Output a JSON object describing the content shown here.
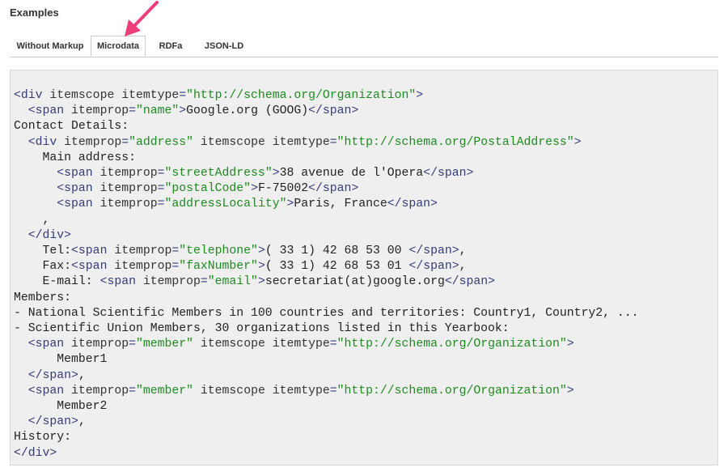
{
  "heading": "Examples",
  "tabs": [
    {
      "label": "Without Markup",
      "active": false
    },
    {
      "label": "Microdata",
      "active": true
    },
    {
      "label": "RDFa",
      "active": false
    },
    {
      "label": "JSON-LD",
      "active": false
    }
  ],
  "annotation_arrow_color": "#ee3d7a",
  "code_lines": [
    [
      [
        "t",
        "<div "
      ],
      [
        "a",
        "itemscope itemtype"
      ],
      [
        "t",
        "="
      ],
      [
        "v",
        "\"http://schema.org/Organization\""
      ],
      [
        "t",
        ">"
      ]
    ],
    [
      [
        "p",
        "  "
      ],
      [
        "t",
        "<span "
      ],
      [
        "a",
        "itemprop"
      ],
      [
        "t",
        "="
      ],
      [
        "v",
        "\"name\""
      ],
      [
        "t",
        ">"
      ],
      [
        "p",
        "Google.org (GOOG)"
      ],
      [
        "t",
        "</span>"
      ]
    ],
    [
      [
        "p",
        "Contact Details:"
      ]
    ],
    [
      [
        "p",
        "  "
      ],
      [
        "t",
        "<div "
      ],
      [
        "a",
        "itemprop"
      ],
      [
        "t",
        "="
      ],
      [
        "v",
        "\"address\""
      ],
      [
        "a",
        " itemscope itemtype"
      ],
      [
        "t",
        "="
      ],
      [
        "v",
        "\"http://schema.org/PostalAddress\""
      ],
      [
        "t",
        ">"
      ]
    ],
    [
      [
        "p",
        "    Main address:"
      ]
    ],
    [
      [
        "p",
        "      "
      ],
      [
        "t",
        "<span "
      ],
      [
        "a",
        "itemprop"
      ],
      [
        "t",
        "="
      ],
      [
        "v",
        "\"streetAddress\""
      ],
      [
        "t",
        ">"
      ],
      [
        "p",
        "38 avenue de l'Opera"
      ],
      [
        "t",
        "</span>"
      ]
    ],
    [
      [
        "p",
        "      "
      ],
      [
        "t",
        "<span "
      ],
      [
        "a",
        "itemprop"
      ],
      [
        "t",
        "="
      ],
      [
        "v",
        "\"postalCode\""
      ],
      [
        "t",
        ">"
      ],
      [
        "p",
        "F-75002"
      ],
      [
        "t",
        "</span>"
      ]
    ],
    [
      [
        "p",
        "      "
      ],
      [
        "t",
        "<span "
      ],
      [
        "a",
        "itemprop"
      ],
      [
        "t",
        "="
      ],
      [
        "v",
        "\"addressLocality\""
      ],
      [
        "t",
        ">"
      ],
      [
        "p",
        "Paris, France"
      ],
      [
        "t",
        "</span>"
      ]
    ],
    [
      [
        "p",
        "    ,"
      ]
    ],
    [
      [
        "p",
        "  "
      ],
      [
        "t",
        "</div>"
      ]
    ],
    [
      [
        "p",
        "    Tel:"
      ],
      [
        "t",
        "<span "
      ],
      [
        "a",
        "itemprop"
      ],
      [
        "t",
        "="
      ],
      [
        "v",
        "\"telephone\""
      ],
      [
        "t",
        ">"
      ],
      [
        "p",
        "( 33 1) 42 68 53 00 "
      ],
      [
        "t",
        "</span>"
      ],
      [
        "p",
        ","
      ]
    ],
    [
      [
        "p",
        "    Fax:"
      ],
      [
        "t",
        "<span "
      ],
      [
        "a",
        "itemprop"
      ],
      [
        "t",
        "="
      ],
      [
        "v",
        "\"faxNumber\""
      ],
      [
        "t",
        ">"
      ],
      [
        "p",
        "( 33 1) 42 68 53 01 "
      ],
      [
        "t",
        "</span>"
      ],
      [
        "p",
        ","
      ]
    ],
    [
      [
        "p",
        "    E-mail: "
      ],
      [
        "t",
        "<span "
      ],
      [
        "a",
        "itemprop"
      ],
      [
        "t",
        "="
      ],
      [
        "v",
        "\"email\""
      ],
      [
        "t",
        ">"
      ],
      [
        "p",
        "secretariat(at)google.org"
      ],
      [
        "t",
        "</span>"
      ]
    ],
    [
      [
        "p",
        "Members:"
      ]
    ],
    [
      [
        "p",
        "- National Scientific Members in 100 countries and territories: Country1, Country2, ..."
      ]
    ],
    [
      [
        "p",
        "- Scientific Union Members, 30 organizations listed in this Yearbook:"
      ]
    ],
    [
      [
        "p",
        "  "
      ],
      [
        "t",
        "<span "
      ],
      [
        "a",
        "itemprop"
      ],
      [
        "t",
        "="
      ],
      [
        "v",
        "\"member\""
      ],
      [
        "a",
        " itemscope itemtype"
      ],
      [
        "t",
        "="
      ],
      [
        "v",
        "\"http://schema.org/Organization\""
      ],
      [
        "t",
        ">"
      ]
    ],
    [
      [
        "p",
        "      Member1"
      ]
    ],
    [
      [
        "p",
        "  "
      ],
      [
        "t",
        "</span>"
      ],
      [
        "p",
        ","
      ]
    ],
    [
      [
        "p",
        "  "
      ],
      [
        "t",
        "<span "
      ],
      [
        "a",
        "itemprop"
      ],
      [
        "t",
        "="
      ],
      [
        "v",
        "\"member\""
      ],
      [
        "a",
        " itemscope itemtype"
      ],
      [
        "t",
        "="
      ],
      [
        "v",
        "\"http://schema.org/Organization\""
      ],
      [
        "t",
        ">"
      ]
    ],
    [
      [
        "p",
        "      Member2"
      ]
    ],
    [
      [
        "p",
        "  "
      ],
      [
        "t",
        "</span>"
      ],
      [
        "p",
        ","
      ]
    ],
    [
      [
        "p",
        "History:"
      ]
    ],
    [
      [
        "t",
        "</div>"
      ]
    ]
  ]
}
